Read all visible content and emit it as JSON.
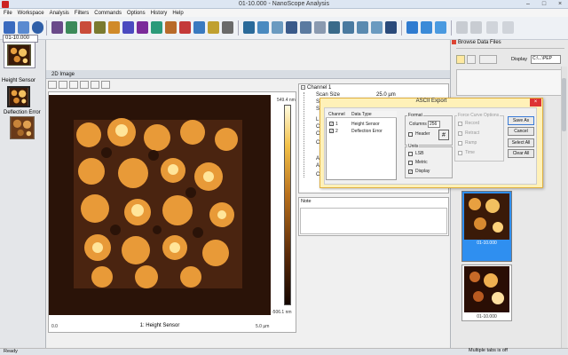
{
  "window": {
    "title": "01-10.000 - NanoScope Analysis"
  },
  "menu": [
    "File",
    "Workspace",
    "Analysis",
    "Filters",
    "Commands",
    "Options",
    "History",
    "Help"
  ],
  "left_panel": {
    "tab": "01-10.000",
    "channel1": "Height Sensor",
    "channel2": "Deflection Error"
  },
  "view": {
    "title": "2D Image",
    "caption": "1: Height Sensor",
    "axis_left": "0.0",
    "axis_right": "5.0 µm",
    "cbar_top": "549.4 nm",
    "cbar_bottom": "-506.1 nm"
  },
  "tree": {
    "title": "Channel 1",
    "items": [
      "Scan Size",
      "S",
      "S",
      "L",
      "C",
      "C",
      "C",
      "A",
      "A",
      "C"
    ],
    "scan_size_value": "25.0 µm"
  },
  "notes": {
    "label": "Note"
  },
  "browse": {
    "title": "Browse Data Files",
    "display": "Display",
    "path": "C:\\...\\PEP",
    "thumb1": "01-10.000",
    "thumb2": "01-10.000"
  },
  "status": {
    "left": "Ready",
    "right": "Multiple tabs is off"
  },
  "dialog": {
    "title": "ASCII Export",
    "col_channel": "Channel",
    "col_data_type": "Data Type",
    "channels": [
      {
        "num": "1",
        "type": "Height Sensor"
      },
      {
        "num": "2",
        "type": "Deflection Error"
      }
    ],
    "format_label": "Format",
    "columns_label": "Columns",
    "columns_value": "256",
    "header_label": "Header",
    "units_label": "Units",
    "units": [
      "LSB",
      "Metric",
      "Display"
    ],
    "force_label": "Force Curve Options",
    "force_opts": [
      "Record",
      "Retract",
      "Ramp",
      "Time"
    ],
    "buttons": [
      "Save As",
      "Cancel",
      "Select All",
      "Clear All"
    ]
  }
}
